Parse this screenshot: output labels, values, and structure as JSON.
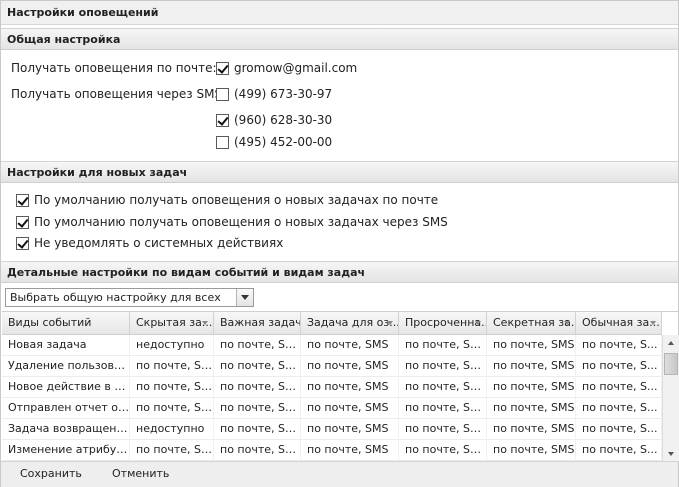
{
  "window": {
    "title": "Настройки оповещений"
  },
  "general": {
    "header": "Общая настройка",
    "email_label": "Получать оповещения по почте:",
    "email": {
      "value": "gromow@gmail.com",
      "checked": true
    },
    "sms_label": "Получать оповещения через SMS:",
    "phones": [
      {
        "value": "(499) 673-30-97",
        "checked": false
      },
      {
        "value": "(960) 628-30-30",
        "checked": true
      },
      {
        "value": "(495) 452-00-00",
        "checked": false
      }
    ]
  },
  "new_tasks": {
    "header": "Настройки для новых задач",
    "options": [
      {
        "label": "По умолчанию получать оповещения о новых задачах по почте",
        "checked": true
      },
      {
        "label": "По умолчанию получать оповещения о новых задачах через SMS",
        "checked": true
      },
      {
        "label": "Не уведомлять о системных действиях",
        "checked": true
      }
    ]
  },
  "detailed": {
    "header": "Детальные настройки по видам событий и видам задач",
    "combo_value": "Выбрать общую настройку для всех",
    "columns": [
      "Виды событий",
      "Скрытая за...",
      "Важная задача",
      "Задача для оз...",
      "Просроченна...",
      "Секретная за...",
      "Обычная за..."
    ],
    "rows": [
      [
        "Новая задача",
        "недоступно",
        "по почте, SMS",
        "по почте, SMS",
        "по почте, SMS",
        "по почте, SMS",
        "по почте, S..."
      ],
      [
        "Удаление пользоват...",
        "по почте, SMS",
        "по почте, SMS",
        "по почте, SMS",
        "по почте, SMS",
        "по почте, SMS",
        "по почте, S..."
      ],
      [
        "Новое действие в з...",
        "по почте, SMS",
        "по почте, SMS",
        "по почте, SMS",
        "по почте, SMS",
        "по почте, SMS",
        "по почте, S..."
      ],
      [
        "Отправлен отчет о ...",
        "по почте, SMS",
        "по почте, SMS",
        "по почте, SMS",
        "по почте, SMS",
        "по почте, SMS",
        "по почте, S..."
      ],
      [
        "Задача возвращена ...",
        "недоступно",
        "по почте, SMS",
        "по почте, SMS",
        "по почте, SMS",
        "по почте, SMS",
        "по почте, S..."
      ],
      [
        "Изменение атрибут...",
        "по почте, SMS",
        "по почте, SMS",
        "по почте, SMS",
        "по почте, SMS",
        "по почте, SMS",
        "по почте, S..."
      ]
    ]
  },
  "footer": {
    "save": "Сохранить",
    "cancel": "Отменить"
  }
}
